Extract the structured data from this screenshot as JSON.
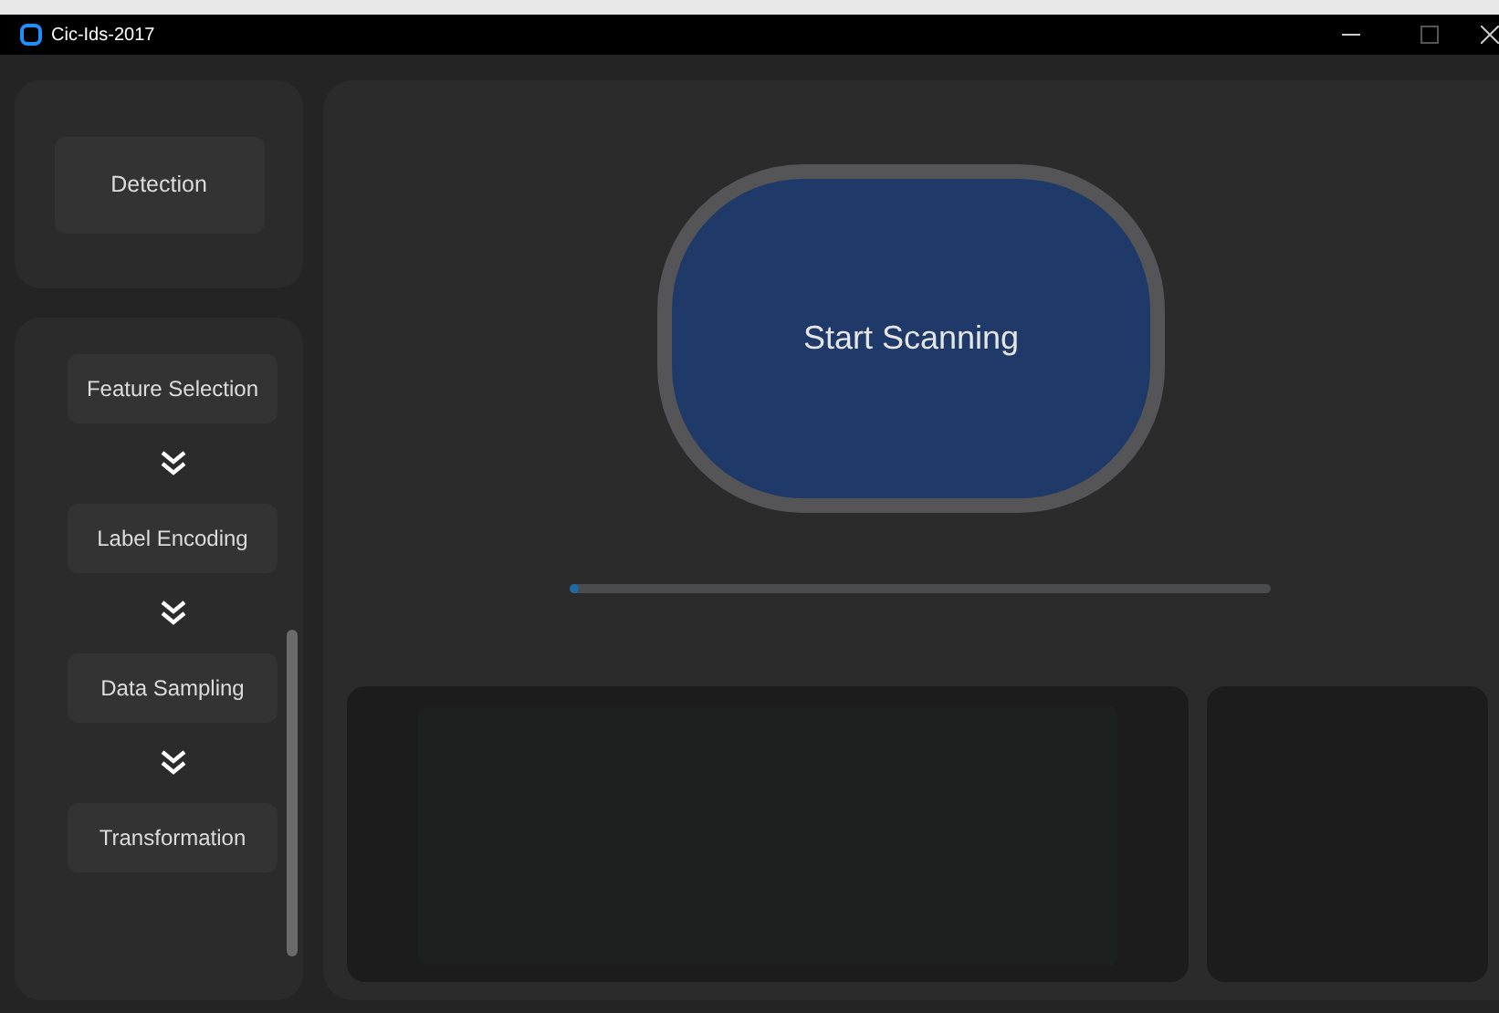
{
  "window": {
    "title": "Cic-Ids-2017"
  },
  "sidebar": {
    "top_button": "Detection",
    "steps": [
      {
        "label": "Feature Selection"
      },
      {
        "label": "Label Encoding"
      },
      {
        "label": "Data Sampling"
      },
      {
        "label": "Transformation"
      }
    ]
  },
  "scan": {
    "button": "Start Scanning",
    "progress": {
      "level": 0.01
    }
  }
}
